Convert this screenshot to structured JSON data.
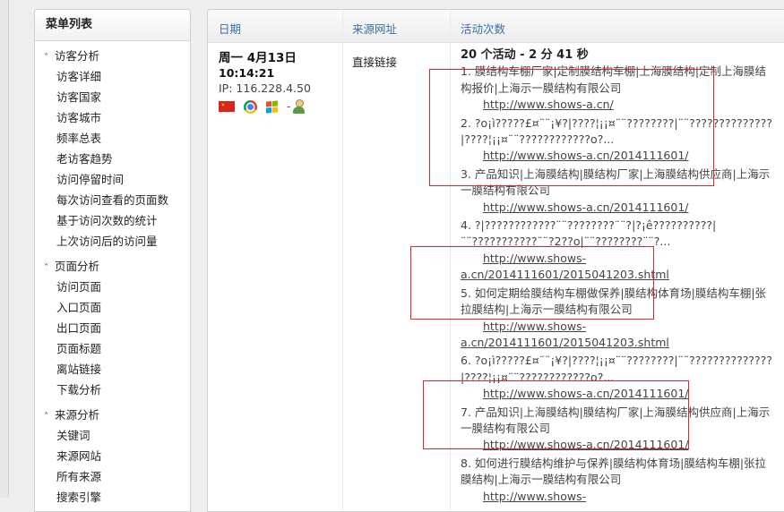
{
  "sidebar": {
    "title": "菜单列表",
    "sections": [
      {
        "label": "访客分析",
        "items": [
          "访客详细",
          "访客国家",
          "访客城市",
          "频率总表",
          "老访客趋势",
          "访问停留时间",
          "每次访问查看的页面数",
          "基于访问次数的统计",
          "上次访问后的访问量"
        ]
      },
      {
        "label": "页面分析",
        "items": [
          "访问页面",
          "入口页面",
          "出口页面",
          "页面标题",
          "离站链接",
          "下载分析"
        ]
      },
      {
        "label": "来源分析",
        "items": [
          "关键词",
          "来源网站",
          "所有来源",
          "搜索引擎"
        ]
      }
    ]
  },
  "table": {
    "headers": {
      "date": "日期",
      "referrer": "来源网址",
      "actions": "活动次数"
    },
    "visit": {
      "date": "周一 4月13日",
      "time": "10:14:21",
      "ip": "IP: 116.228.4.50",
      "icons": [
        "china-flag-icon",
        "chrome-icon",
        "windows-icon",
        "visitor-icon"
      ],
      "separator": "-",
      "referrer": "直接链接",
      "summary": "20 个活动 - 2 分 41 秒",
      "actions": [
        {
          "title": "1. 膜结构车棚厂家|定制膜结构车棚|上海膜结构|定制上海膜结构报价|上海示一膜结构有限公司",
          "url": "http://www.shows-a.cn/"
        },
        {
          "title": "2. ?o¡ì?????£¤¨¨¡¥?|????¦¡¡¤¨¨????????|¨¨??????????????|????¦¡¡¤¨¨????????????o?...",
          "url": "http://www.shows-a.cn/2014111601/"
        },
        {
          "title": "3. 产品知识|上海膜结构|膜结构厂家|上海膜结构供应商|上海示一膜结构有限公司",
          "url": "http://www.shows-a.cn/2014111601/"
        },
        {
          "title": "4. ?|????????????¨¨????????¨¨?|?¡ê??????????|¨¨???????????¨¨?2??o|¨¨????????¨¨?...",
          "url1": "http://www.shows-",
          "url2": "a.cn/2014111601/2015041203.shtml"
        },
        {
          "title": "5. 如何定期给膜结构车棚做保养|膜结构体育场|膜结构车棚|张拉膜结构|上海示一膜结构有限公司",
          "url1": "http://www.shows-",
          "url2": "a.cn/2014111601/2015041203.shtml"
        },
        {
          "title": "6. ?o¡ì?????£¤¨¨¡¥?|????¦¡¡¤¨¨????????|¨¨??????????????|????¦¡¡¤¨¨????????????o?...",
          "url": "http://www.shows-a.cn/2014111601/"
        },
        {
          "title": "7. 产品知识|上海膜结构|膜结构厂家|上海膜结构供应商|上海示一膜结构有限公司",
          "url": "http://www.shows-a.cn/2014111601/"
        },
        {
          "title": "8. 如何进行膜结构维护与保养|膜结构体育场|膜结构车棚|张拉膜结构|上海示一膜结构有限公司",
          "url1": "http://www.shows-",
          "url2": ""
        }
      ]
    }
  },
  "colors": {
    "header_link": "#3a6fa6",
    "highlight_box": "#e0262a"
  }
}
